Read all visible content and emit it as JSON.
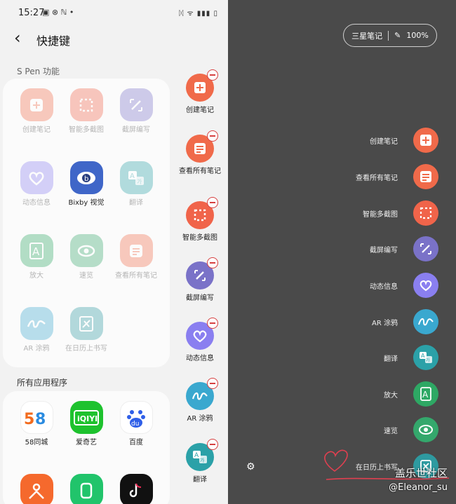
{
  "status": {
    "time": "15:27"
  },
  "header": {
    "title": "快捷键"
  },
  "sections": {
    "spen": "S Pen 功能",
    "all_apps": "所有应用程序"
  },
  "spen_items": [
    {
      "label": "创建笔记",
      "color": "#f06a4a"
    },
    {
      "label": "智能多截图",
      "color": "#f0644a"
    },
    {
      "label": "截屏编写",
      "color": "#7a72c8"
    },
    {
      "label": "动态信息",
      "color": "#8a7ff0"
    },
    {
      "label": "Bixby 视觉",
      "color": "#3f66c8"
    },
    {
      "label": "翻译",
      "color": "#2ba1a8"
    },
    {
      "label": "放大",
      "color": "#2ea864"
    },
    {
      "label": "速览",
      "color": "#34a86c"
    },
    {
      "label": "查看所有笔记",
      "color": "#f06a4a"
    },
    {
      "label": "AR 涂鸦",
      "color": "#3aa8cf"
    },
    {
      "label": "在日历上书写",
      "color": "#2e9aa0"
    }
  ],
  "apps": [
    {
      "label": "58同城"
    },
    {
      "label": "爱奇艺"
    },
    {
      "label": "百度"
    }
  ],
  "sidebar_items": [
    {
      "label": "创建笔记",
      "color": "#f06a4a"
    },
    {
      "label": "查看所有笔记",
      "color": "#f06a4a"
    },
    {
      "label": "智能多截图",
      "color": "#f0644a"
    },
    {
      "label": "截屏编写",
      "color": "#7a72c8"
    },
    {
      "label": "动态信息",
      "color": "#8a7ff0"
    },
    {
      "label": "AR 涂鸦",
      "color": "#3aa8cf"
    },
    {
      "label": "翻译",
      "color": "#2ba1a8"
    }
  ],
  "right": {
    "pill_app": "三星笔记",
    "pill_battery": "100%",
    "items": [
      {
        "label": "创建笔记",
        "color": "#f06a4a"
      },
      {
        "label": "查看所有笔记",
        "color": "#f06a4a"
      },
      {
        "label": "智能多截图",
        "color": "#f0644a"
      },
      {
        "label": "截屏编写",
        "color": "#7a72c8"
      },
      {
        "label": "动态信息",
        "color": "#8a7ff0"
      },
      {
        "label": "AR 涂鸦",
        "color": "#3aa8cf"
      },
      {
        "label": "翻译",
        "color": "#2ba1a8"
      },
      {
        "label": "放大",
        "color": "#2ea864"
      },
      {
        "label": "速览",
        "color": "#34a86c"
      },
      {
        "label": "在日历上书写",
        "color": "#2e9aa0"
      }
    ],
    "watermark_1": "盖乐世社区",
    "watermark_2": "@Eleanor_su"
  }
}
